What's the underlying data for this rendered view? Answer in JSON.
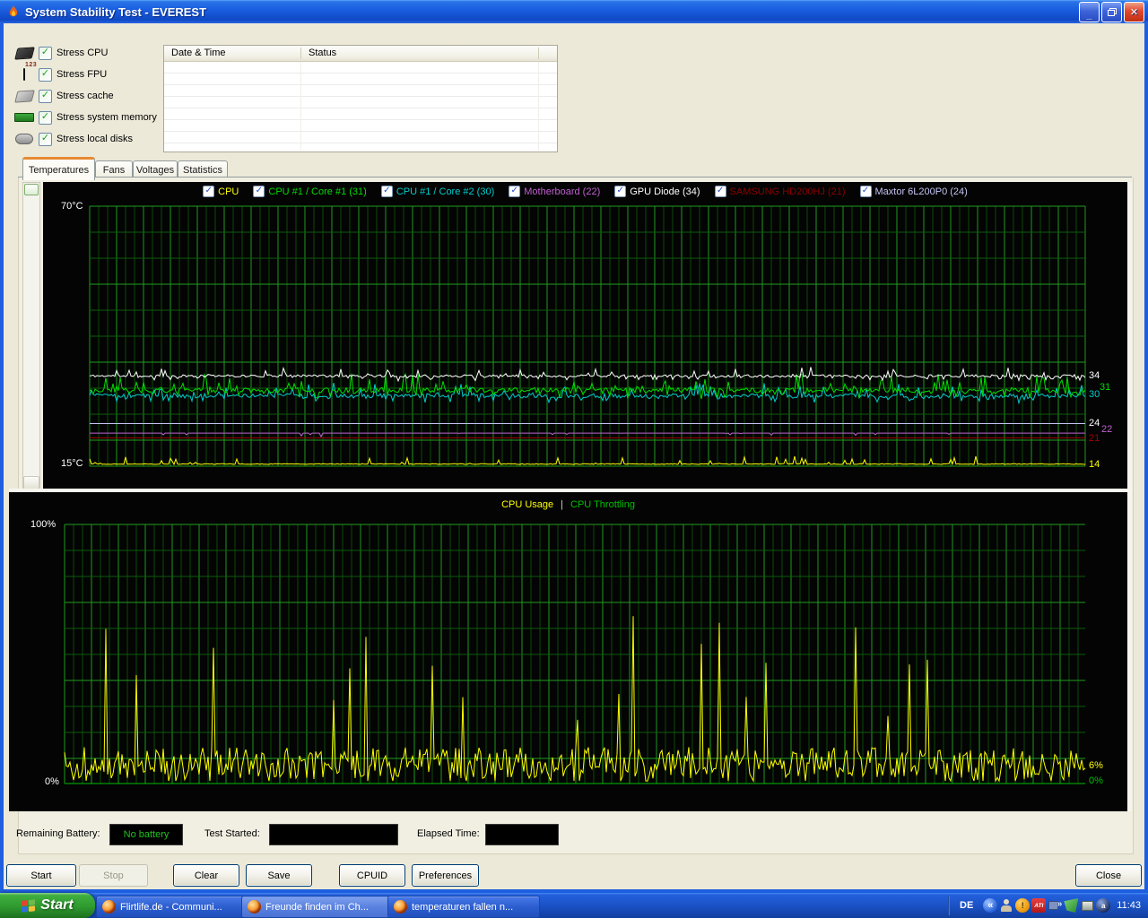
{
  "window": {
    "title": "System Stability Test - EVEREST",
    "app_icon": "everest-flame-icon"
  },
  "stress_options": [
    {
      "label": "Stress CPU",
      "icon": "cpu-chip-icon",
      "checked": true
    },
    {
      "label": "Stress FPU",
      "icon": "fpu-chip-icon",
      "checked": true
    },
    {
      "label": "Stress cache",
      "icon": "cache-chip-icon",
      "checked": true
    },
    {
      "label": "Stress system memory",
      "icon": "memory-module-icon",
      "checked": true
    },
    {
      "label": "Stress local disks",
      "icon": "hard-disk-icon",
      "checked": true
    }
  ],
  "log_table": {
    "columns": [
      "Date & Time",
      "Status"
    ],
    "rows": []
  },
  "tabs": [
    {
      "label": "Temperatures",
      "active": true
    },
    {
      "label": "Fans",
      "active": false
    },
    {
      "label": "Voltages",
      "active": false
    },
    {
      "label": "Statistics",
      "active": false
    }
  ],
  "temp_chart": {
    "axis_top": "70°C",
    "axis_bottom": "15°C",
    "legend": [
      {
        "label": "CPU",
        "color": "#ffff00",
        "checked": true
      },
      {
        "label": "CPU #1 / Core #1 (31)",
        "color": "#00dd00",
        "checked": true
      },
      {
        "label": "CPU #1 / Core #2 (30)",
        "color": "#00cccc",
        "checked": true
      },
      {
        "label": "Motherboard (22)",
        "color": "#c060d0",
        "checked": true
      },
      {
        "label": "GPU Diode (34)",
        "color": "#ffffff",
        "checked": true
      },
      {
        "label": "SAMSUNG HD200HJ (21)",
        "color": "#8b0000",
        "checked": true
      },
      {
        "label": "Maxtor 6L200P0 (24)",
        "color": "#c4c4f4",
        "checked": true
      }
    ],
    "current_labels": [
      {
        "text": "34",
        "value": 34,
        "color": "#ffffff",
        "dx": 2,
        "dy": 0
      },
      {
        "text": "31",
        "value": 31,
        "color": "#00dd00",
        "dx": 14,
        "dy": -3
      },
      {
        "text": "30",
        "value": 30,
        "color": "#00cccc",
        "dx": 2,
        "dy": 0
      },
      {
        "text": "24",
        "value": 24,
        "color": "#ffffff",
        "dx": 2,
        "dy": 0
      },
      {
        "text": "22",
        "value": 22,
        "color": "#c060d0",
        "dx": 16,
        "dy": -3
      },
      {
        "text": "21",
        "value": 21,
        "color": "#a00000",
        "dx": 2,
        "dy": 2
      },
      {
        "text": "14",
        "value": 15.4,
        "color": "#ffff00",
        "dx": 2,
        "dy": 1
      }
    ]
  },
  "usage_chart": {
    "title_left": "CPU Usage",
    "divider": "|",
    "title_right": "CPU Throttling",
    "axis_top": "100%",
    "axis_bottom": "0%",
    "current_labels": [
      {
        "text": "6%",
        "value": 6,
        "color": "#ffff00",
        "dx": 2,
        "dy": -2
      },
      {
        "text": "0%",
        "value": 0,
        "color": "#00c000",
        "dx": 2,
        "dy": -2
      }
    ]
  },
  "status_bar": {
    "battery_label": "Remaining Battery:",
    "battery_value": "No battery",
    "started_label": "Test Started:",
    "started_value": "",
    "elapsed_label": "Elapsed Time:",
    "elapsed_value": ""
  },
  "action_buttons": [
    {
      "label": "Start",
      "enabled": true
    },
    {
      "label": "Stop",
      "enabled": false
    },
    {
      "label": "Clear",
      "enabled": true
    },
    {
      "label": "Save",
      "enabled": true
    },
    {
      "label": "CPUID",
      "enabled": true
    },
    {
      "label": "Preferences",
      "enabled": true
    }
  ],
  "close_button": {
    "label": "Close"
  },
  "taskbar": {
    "start_label": "Start",
    "tasks": [
      {
        "label": "Flirtlife.de - Communi...",
        "icon": "firefox-icon",
        "active": false
      },
      {
        "label": "Freunde finden im Ch...",
        "icon": "firefox-icon",
        "active": true
      },
      {
        "label": "temperaturen fallen n...",
        "icon": "firefox-icon",
        "active": false
      }
    ],
    "language_indicator": "DE",
    "tray_icons": [
      "hide-icons-chevron-icon",
      "user-icon",
      "warning-icon",
      "ati-icon",
      "network-monitor-icon",
      "green-utility-icon",
      "display-settings-icon",
      "sphere-app-icon"
    ],
    "clock": "11:43"
  },
  "chart_data": [
    {
      "type": "line",
      "title": "Temperatures",
      "ylabel": "°C",
      "ylim": [
        15,
        70
      ],
      "grid": true,
      "legend_position": "top",
      "series": [
        {
          "name": "GPU Diode",
          "color": "#ffffff",
          "current": 34,
          "baseline": 34,
          "range": [
            33,
            36
          ],
          "z": 7,
          "gen": {
            "seed": 11,
            "base": 34.1,
            "noise": 0.25,
            "upProb": 0.08,
            "upAmp": 1.7,
            "downProb": 0.15,
            "downAmp": 0.9,
            "min": 32.8,
            "max": 36.5
          }
        },
        {
          "name": "CPU #1 / Core #1",
          "color": "#00dd00",
          "current": 31,
          "baseline": 31,
          "range": [
            29,
            36
          ],
          "z": 6,
          "gen": {
            "seed": 22,
            "base": 31.1,
            "noise": 0.55,
            "upProb": 0.15,
            "upAmp": 3.4,
            "downProb": 0.15,
            "downAmp": 1.5,
            "min": 29,
            "max": 36.5
          }
        },
        {
          "name": "CPU #1 / Core #2",
          "color": "#00cccc",
          "current": 30,
          "baseline": 30,
          "range": [
            28,
            34
          ],
          "z": 5,
          "gen": {
            "seed": 33,
            "base": 29.9,
            "noise": 0.45,
            "upProb": 0.13,
            "upAmp": 2.4,
            "downProb": 0.12,
            "downAmp": 1.2,
            "min": 28,
            "max": 35
          }
        },
        {
          "name": "CPU",
          "color": "#ffff00",
          "current": 14,
          "baseline": 15.4,
          "range": [
            14,
            17
          ],
          "z": 4,
          "gen": {
            "seed": 77,
            "base": 15.45,
            "noise": 0.08,
            "upProb": 0.09,
            "upAmp": 1.6,
            "downProb": 0,
            "downAmp": 0,
            "min": 15.35,
            "max": 18
          }
        },
        {
          "name": "Maxtor 6L200P0",
          "color": "#c4c4f4",
          "current": 24,
          "baseline": 24,
          "range": [
            24,
            24
          ],
          "z": 1,
          "gen": {
            "seed": 44,
            "base": 24,
            "noise": 0,
            "upProb": 0,
            "upAmp": 0,
            "downProb": 0,
            "downAmp": 0
          }
        },
        {
          "name": "Motherboard",
          "color": "#c060d0",
          "current": 22,
          "baseline": 22,
          "range": [
            21,
            22
          ],
          "z": 2,
          "gen": {
            "seed": 55,
            "base": 22,
            "noise": 0,
            "upProb": 0,
            "upAmp": 0,
            "downProb": 0.03,
            "downAmp": 0.8
          }
        },
        {
          "name": "SAMSUNG HD200HJ",
          "color": "#a00000",
          "current": 21,
          "baseline": 21,
          "range": [
            21,
            21
          ],
          "z": 3,
          "gen": {
            "seed": 66,
            "base": 21,
            "noise": 0,
            "upProb": 0,
            "upAmp": 0,
            "downProb": 0,
            "downAmp": 0
          }
        }
      ]
    },
    {
      "type": "line",
      "title": "CPU Usage | CPU Throttling",
      "ylabel": "%",
      "ylim": [
        0,
        100
      ],
      "grid": true,
      "series": [
        {
          "name": "CPU Usage",
          "color": "#ffff00",
          "current": 6,
          "baseline": 8,
          "range": [
            1,
            75
          ],
          "z": 2,
          "gen": {
            "seed": 88,
            "base": 8,
            "noise": 6,
            "upProb": 0.05,
            "upAmp": 55,
            "downProb": 0.25,
            "downAmp": 5,
            "min": 1,
            "max": 78,
            "last": 6
          }
        },
        {
          "name": "CPU Throttling",
          "color": "#00c000",
          "current": 0,
          "baseline": 0,
          "range": [
            0,
            0
          ],
          "z": 1,
          "gen": {
            "seed": 99,
            "base": 0,
            "noise": 0,
            "upProb": 0,
            "upAmp": 0,
            "downProb": 0,
            "downAmp": 0,
            "min": 0,
            "max": 0
          }
        }
      ]
    }
  ]
}
